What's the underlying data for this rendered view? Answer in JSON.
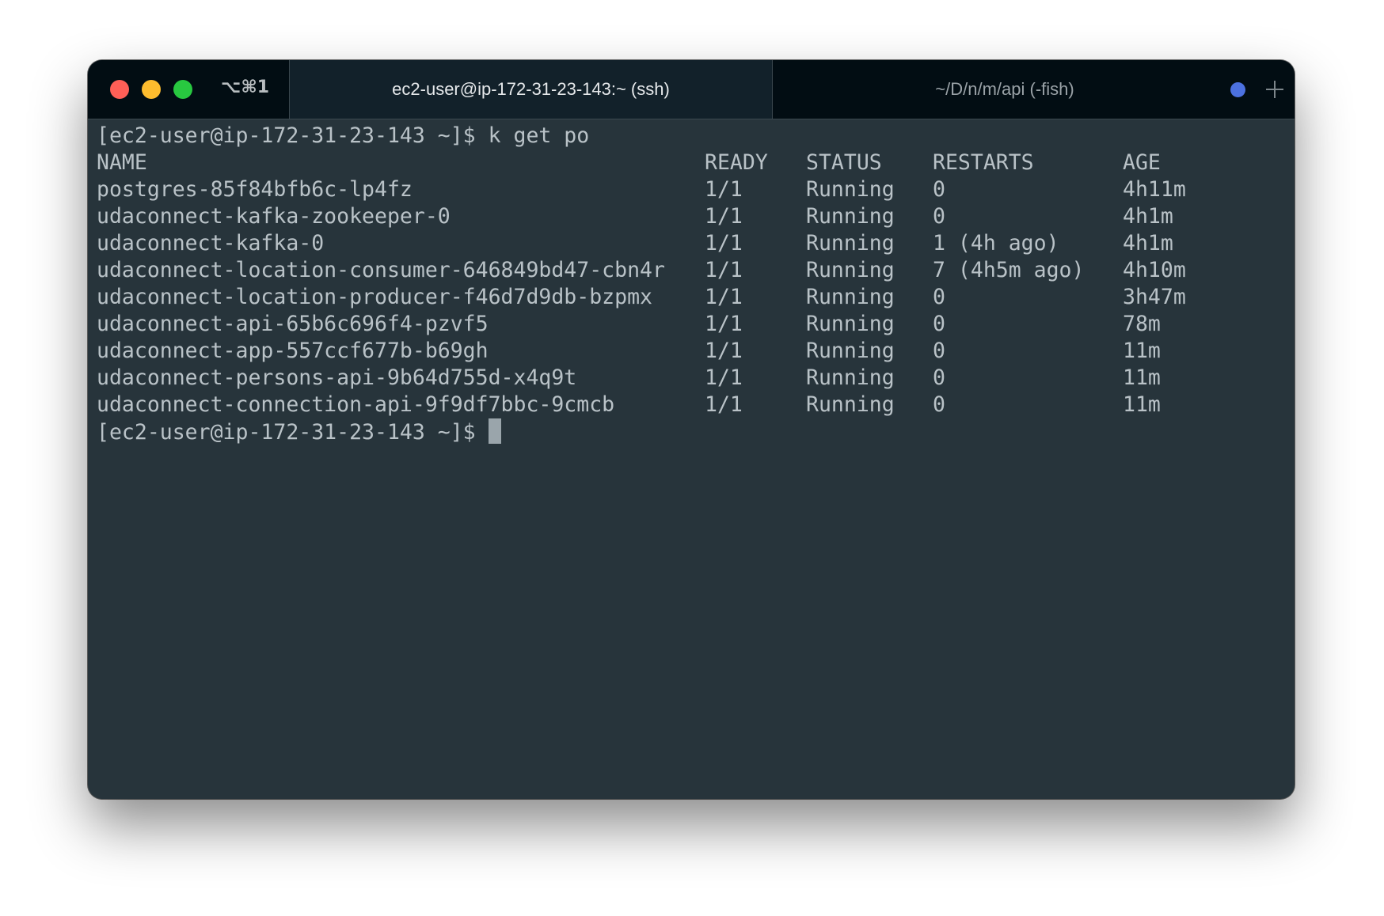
{
  "window": {
    "shortcut": "⌥⌘1",
    "tabs": [
      {
        "label": "ec2-user@ip-172-31-23-143:~ (ssh)",
        "active": true
      },
      {
        "label": "~/D/n/m/api (-fish)",
        "active": false
      }
    ],
    "icons": {
      "close": "close-traffic-light",
      "minimize": "minimize-traffic-light",
      "zoom": "zoom-traffic-light",
      "activity": "activity-dot-icon",
      "new_tab": "plus-icon"
    },
    "colors": {
      "terminal_bg": "#27343b",
      "titlebar_bg": "#020d13",
      "text": "#b9c2c7",
      "activity_dot": "#4c71e0"
    }
  },
  "terminal": {
    "command_line": "[ec2-user@ip-172-31-23-143 ~]$ k get po",
    "headers": {
      "name": "NAME",
      "ready": "READY",
      "status": "STATUS",
      "restarts": "RESTARTS",
      "age": "AGE"
    },
    "rows": [
      {
        "name": "postgres-85f84bfb6c-lp4fz",
        "ready": "1/1",
        "status": "Running",
        "restarts": "0",
        "age": "4h11m"
      },
      {
        "name": "udaconnect-kafka-zookeeper-0",
        "ready": "1/1",
        "status": "Running",
        "restarts": "0",
        "age": "4h1m"
      },
      {
        "name": "udaconnect-kafka-0",
        "ready": "1/1",
        "status": "Running",
        "restarts": "1 (4h ago)",
        "age": "4h1m"
      },
      {
        "name": "udaconnect-location-consumer-646849bd47-cbn4r",
        "ready": "1/1",
        "status": "Running",
        "restarts": "7 (4h5m ago)",
        "age": "4h10m"
      },
      {
        "name": "udaconnect-location-producer-f46d7d9db-bzpmx",
        "ready": "1/1",
        "status": "Running",
        "restarts": "0",
        "age": "3h47m"
      },
      {
        "name": "udaconnect-api-65b6c696f4-pzvf5",
        "ready": "1/1",
        "status": "Running",
        "restarts": "0",
        "age": "78m"
      },
      {
        "name": "udaconnect-app-557ccf677b-b69gh",
        "ready": "1/1",
        "status": "Running",
        "restarts": "0",
        "age": "11m"
      },
      {
        "name": "udaconnect-persons-api-9b64d755d-x4q9t",
        "ready": "1/1",
        "status": "Running",
        "restarts": "0",
        "age": "11m"
      },
      {
        "name": "udaconnect-connection-api-9f9df7bbc-9cmcb",
        "ready": "1/1",
        "status": "Running",
        "restarts": "0",
        "age": "11m"
      }
    ],
    "prompt": "[ec2-user@ip-172-31-23-143 ~]$"
  }
}
